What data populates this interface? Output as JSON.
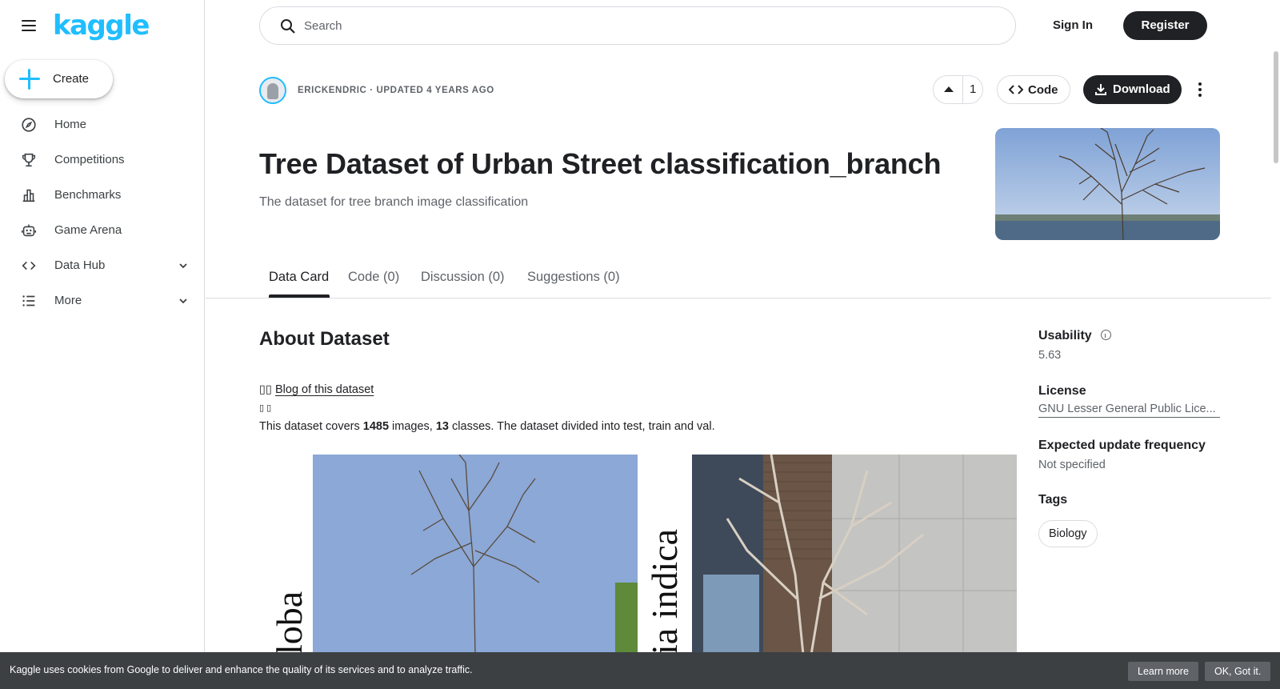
{
  "sidebar": {
    "logo": "kaggle",
    "create_label": "Create",
    "items": [
      {
        "label": "Home",
        "icon": "compass-icon"
      },
      {
        "label": "Competitions",
        "icon": "trophy-icon"
      },
      {
        "label": "Benchmarks",
        "icon": "bar-chart-icon"
      },
      {
        "label": "Game Arena",
        "icon": "robot-icon"
      },
      {
        "label": "Data Hub",
        "icon": "code-brackets-icon"
      },
      {
        "label": "More",
        "icon": "list-icon"
      }
    ]
  },
  "header": {
    "search_placeholder": "Search",
    "sign_in": "Sign In",
    "register": "Register"
  },
  "dataset": {
    "author": "ERICKENDRIC · UPDATED 4 YEARS AGO",
    "vote_count": "1",
    "code_label": "Code",
    "download_label": "Download",
    "title": "Tree Dataset of Urban Street classification_branch",
    "subtitle": "The dataset for tree branch image classification"
  },
  "tabs": [
    {
      "label": "Data Card",
      "active": true
    },
    {
      "label": "Code (0)",
      "active": false
    },
    {
      "label": "Discussion (0)",
      "active": false
    },
    {
      "label": "Suggestions (0)",
      "active": false
    }
  ],
  "about": {
    "heading": "About Dataset",
    "blog_prefix": "▯▯",
    "blog_link": "Blog of this dataset",
    "small_icons": "▯ ▯",
    "desc_1": "This dataset covers ",
    "images_count": "1485",
    "desc_2": " images, ",
    "classes_count": "13",
    "desc_3": " classes. The dataset divided into test, train and val.",
    "image_label_left": "loba",
    "image_label_right": "ia indica"
  },
  "meta": {
    "usability_label": "Usability",
    "usability_value": "5.63",
    "license_label": "License",
    "license_value": "GNU Lesser General Public Lice...",
    "frequency_label": "Expected update frequency",
    "frequency_value": "Not specified",
    "tags_label": "Tags",
    "tags": [
      "Biology"
    ]
  },
  "cookie": {
    "text": "Kaggle uses cookies from Google to deliver and enhance the quality of its services and to analyze traffic.",
    "learn_more": "Learn more",
    "ok": "OK, Got it."
  },
  "colors": {
    "brand": "#20beff",
    "primary_dark": "#202124",
    "cookie_bg": "#3c4043"
  }
}
